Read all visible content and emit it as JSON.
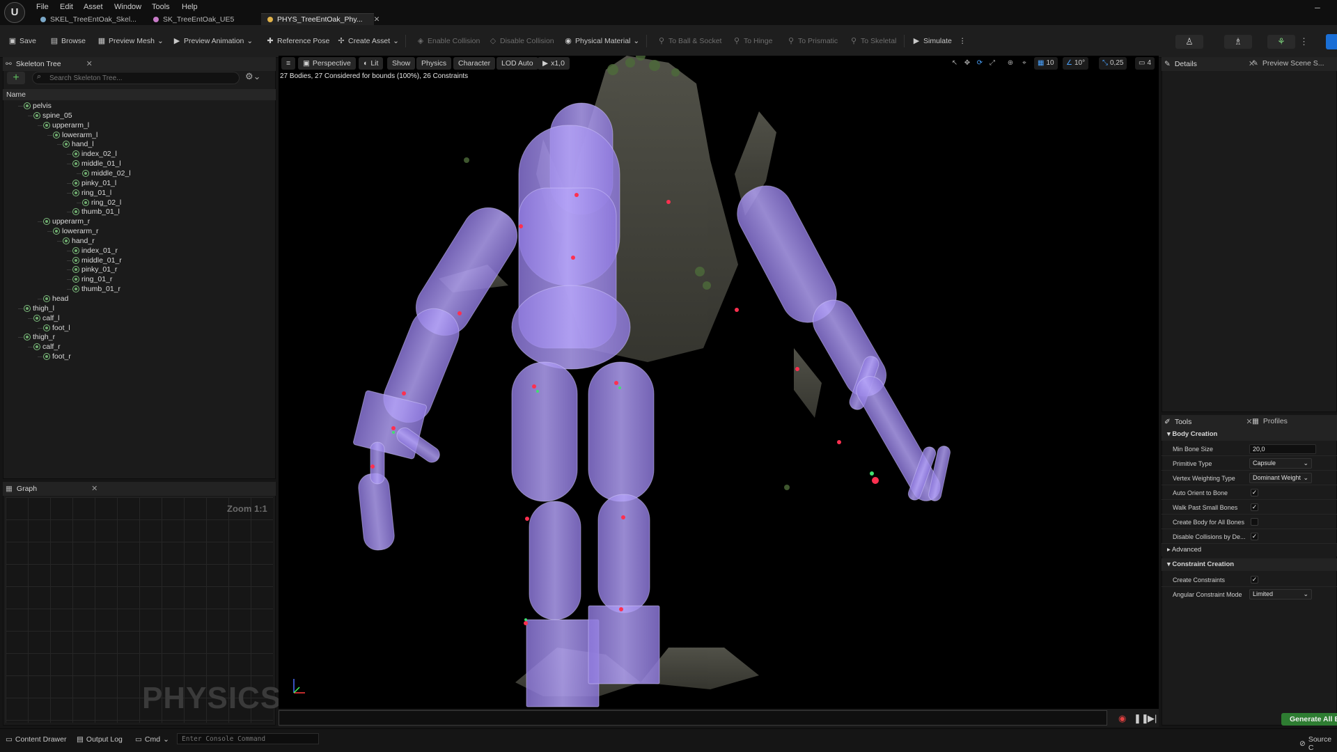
{
  "menu": [
    "File",
    "Edit",
    "Asset",
    "Window",
    "Tools",
    "Help"
  ],
  "doc_tabs": [
    {
      "label": "SKEL_TreeEntOak_Skel...",
      "color": "#7aa7c7"
    },
    {
      "label": "SK_TreeEntOak_UE5",
      "color": "#c77ac7"
    },
    {
      "label": "PHYS_TreeEntOak_Phy...",
      "color": "#e0b24a",
      "active": true
    }
  ],
  "toolbar": {
    "save": "Save",
    "browse": "Browse",
    "preview_mesh": "Preview Mesh",
    "preview_animation": "Preview Animation",
    "reference_pose": "Reference Pose",
    "create_asset": "Create Asset",
    "enable_collision": "Enable Collision",
    "disable_collision": "Disable Collision",
    "physical_material": "Physical Material",
    "to_ball_socket": "To Ball & Socket",
    "to_hinge": "To Hinge",
    "to_prismatic": "To Prismatic",
    "to_skeletal": "To Skeletal",
    "simulate": "Simulate"
  },
  "skeleton_tree": {
    "tab": "Skeleton Tree",
    "search_placeholder": "Search Skeleton Tree...",
    "column": "Name",
    "bones": [
      {
        "name": "pelvis",
        "depth": 0
      },
      {
        "name": "spine_05",
        "depth": 1
      },
      {
        "name": "upperarm_l",
        "depth": 2
      },
      {
        "name": "lowerarm_l",
        "depth": 3
      },
      {
        "name": "hand_l",
        "depth": 4
      },
      {
        "name": "index_02_l",
        "depth": 5
      },
      {
        "name": "middle_01_l",
        "depth": 5
      },
      {
        "name": "middle_02_l",
        "depth": 6
      },
      {
        "name": "pinky_01_l",
        "depth": 5
      },
      {
        "name": "ring_01_l",
        "depth": 5
      },
      {
        "name": "ring_02_l",
        "depth": 6
      },
      {
        "name": "thumb_01_l",
        "depth": 5
      },
      {
        "name": "upperarm_r",
        "depth": 2
      },
      {
        "name": "lowerarm_r",
        "depth": 3
      },
      {
        "name": "hand_r",
        "depth": 4
      },
      {
        "name": "index_01_r",
        "depth": 5
      },
      {
        "name": "middle_01_r",
        "depth": 5
      },
      {
        "name": "pinky_01_r",
        "depth": 5
      },
      {
        "name": "ring_01_r",
        "depth": 5
      },
      {
        "name": "thumb_01_r",
        "depth": 5
      },
      {
        "name": "head",
        "depth": 2
      },
      {
        "name": "thigh_l",
        "depth": 0
      },
      {
        "name": "calf_l",
        "depth": 1
      },
      {
        "name": "foot_l",
        "depth": 2
      },
      {
        "name": "thigh_r",
        "depth": 0
      },
      {
        "name": "calf_r",
        "depth": 1
      },
      {
        "name": "foot_r",
        "depth": 2
      }
    ]
  },
  "graph": {
    "tab": "Graph",
    "zoom": "Zoom 1:1",
    "watermark": "PHYSICS"
  },
  "viewport": {
    "perspective": "Perspective",
    "lit": "Lit",
    "show": "Show",
    "physics": "Physics",
    "character": "Character",
    "lod": "LOD Auto",
    "play_rate": "x1,0",
    "grid_size": "10",
    "rot_snap": "10°",
    "scale_snap": "0,25",
    "cam_speed": "4",
    "stats": "27 Bodies, 27 Considered for bounds (100%), 26 Constraints",
    "body_color": "#a28cf0"
  },
  "details": {
    "tab": "Details",
    "tab2": "Preview Scene S..."
  },
  "tools": {
    "tab": "Tools",
    "tab2": "Profiles",
    "body_creation": "Body Creation",
    "min_bone_size_label": "Min Bone Size",
    "min_bone_size": "20,0",
    "primitive_type_label": "Primitive Type",
    "primitive_type": "Capsule",
    "vertex_weighting_label": "Vertex Weighting Type",
    "vertex_weighting": "Dominant Weight",
    "auto_orient_label": "Auto Orient to Bone",
    "walk_past_label": "Walk Past Small Bones",
    "create_body_all_label": "Create Body for All Bones",
    "disable_collisions_label": "Disable Collisions by De...",
    "advanced": "Advanced",
    "constraint_creation": "Constraint Creation",
    "create_constraints_label": "Create Constraints",
    "angular_mode_label": "Angular Constraint Mode",
    "angular_mode": "Limited",
    "generate": "Generate All Bodies"
  },
  "statusbar": {
    "content_drawer": "Content Drawer",
    "output_log": "Output Log",
    "cmd": "Cmd",
    "console_placeholder": "Enter Console Command",
    "source_control": "Source C"
  }
}
